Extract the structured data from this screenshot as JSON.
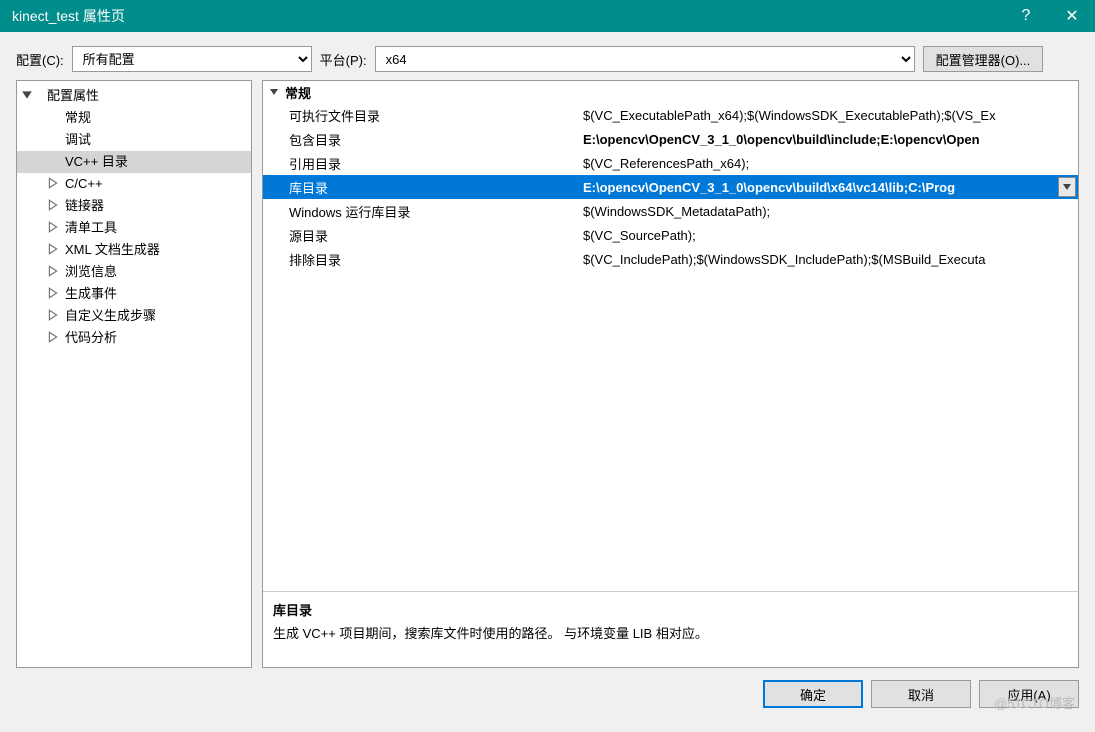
{
  "title": "kinect_test 属性页",
  "toolbar": {
    "config_label": "配置(C):",
    "config_value": "所有配置",
    "platform_label": "平台(P):",
    "platform_value": "x64",
    "manager_button": "配置管理器(O)..."
  },
  "tree": {
    "root": "配置属性",
    "items": [
      {
        "label": "常规",
        "expand": false,
        "level": 2
      },
      {
        "label": "调试",
        "expand": false,
        "level": 2
      },
      {
        "label": "VC++ 目录",
        "expand": false,
        "level": 2,
        "sel": true
      },
      {
        "label": "C/C++",
        "expand": true,
        "level": 2,
        "arrow": true
      },
      {
        "label": "链接器",
        "expand": true,
        "level": 2,
        "arrow": true
      },
      {
        "label": "清单工具",
        "expand": true,
        "level": 2,
        "arrow": true
      },
      {
        "label": "XML 文档生成器",
        "expand": true,
        "level": 2,
        "arrow": true
      },
      {
        "label": "浏览信息",
        "expand": true,
        "level": 2,
        "arrow": true
      },
      {
        "label": "生成事件",
        "expand": true,
        "level": 2,
        "arrow": true
      },
      {
        "label": "自定义生成步骤",
        "expand": true,
        "level": 2,
        "arrow": true
      },
      {
        "label": "代码分析",
        "expand": true,
        "level": 2,
        "arrow": true
      }
    ]
  },
  "properties": {
    "group": "常规",
    "rows": [
      {
        "key": "可执行文件目录",
        "val": "$(VC_ExecutablePath_x64);$(WindowsSDK_ExecutablePath);$(VS_Ex"
      },
      {
        "key": "包含目录",
        "val": "E:\\opencv\\OpenCV_3_1_0\\opencv\\build\\include;E:\\opencv\\Open",
        "bold": true
      },
      {
        "key": "引用目录",
        "val": "$(VC_ReferencesPath_x64);"
      },
      {
        "key": "库目录",
        "val": "E:\\opencv\\OpenCV_3_1_0\\opencv\\build\\x64\\vc14\\lib;C:\\Prog",
        "sel": true,
        "drop": true
      },
      {
        "key": "Windows 运行库目录",
        "val": "$(WindowsSDK_MetadataPath);"
      },
      {
        "key": "源目录",
        "val": "$(VC_SourcePath);"
      },
      {
        "key": "排除目录",
        "val": "$(VC_IncludePath);$(WindowsSDK_IncludePath);$(MSBuild_Executa"
      }
    ]
  },
  "description": {
    "title": "库目录",
    "text": "生成 VC++ 项目期间，搜索库文件时使用的路径。 与环境变量 LIB 相对应。"
  },
  "buttons": {
    "ok": "确定",
    "cancel": "取消",
    "apply": "应用(A)"
  },
  "watermark": "@51CTO博客"
}
